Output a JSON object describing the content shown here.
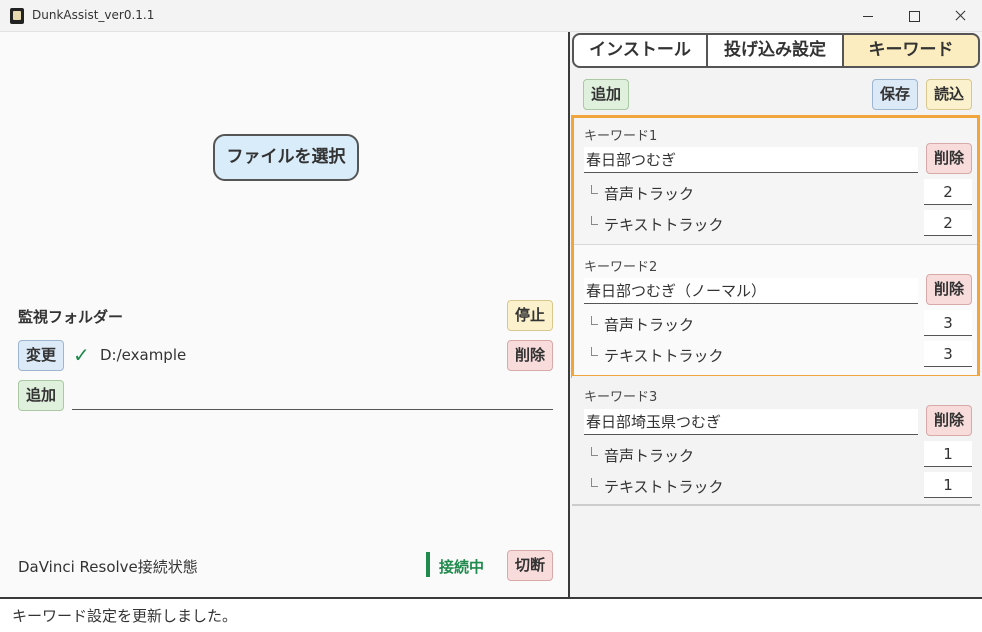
{
  "window": {
    "title": "DunkAssist_ver0.1.1"
  },
  "left": {
    "select_file_label": "ファイルを選択",
    "watch_folder_label": "監視フォルダー",
    "stop_label": "停止",
    "change_label": "変更",
    "folder_path": "D:/example",
    "delete_label": "削除",
    "add_label": "追加",
    "add_input_value": "",
    "resolve_status_label": "DaVinci Resolve接続状態",
    "connection_status": "接続中",
    "disconnect_label": "切断"
  },
  "tabs": [
    {
      "label": "インストール"
    },
    {
      "label": "投げ込み設定"
    },
    {
      "label": "キーワード",
      "active": true
    }
  ],
  "toolbar": {
    "add_label": "追加",
    "save_label": "保存",
    "load_label": "読込"
  },
  "keywords": [
    {
      "title": "キーワード1",
      "name": "春日部つむぎ",
      "audio_track_label": "音声トラック",
      "audio_track": "2",
      "text_track_label": "テキストトラック",
      "text_track": "2",
      "delete_label": "削除"
    },
    {
      "title": "キーワード2",
      "name": "春日部つむぎ（ノーマル）",
      "audio_track_label": "音声トラック",
      "audio_track": "3",
      "text_track_label": "テキストトラック",
      "text_track": "3",
      "delete_label": "削除"
    },
    {
      "title": "キーワード3",
      "name": "春日部埼玉県つむぎ",
      "audio_track_label": "音声トラック",
      "audio_track": "1",
      "text_track_label": "テキストトラック",
      "text_track": "1",
      "delete_label": "削除"
    }
  ],
  "statusbar": {
    "message": "キーワード設定を更新しました。"
  },
  "colors": {
    "accent_orange": "#f0a63c",
    "connected_green": "#1f8a4c",
    "active_tab": "#fbedbf"
  }
}
